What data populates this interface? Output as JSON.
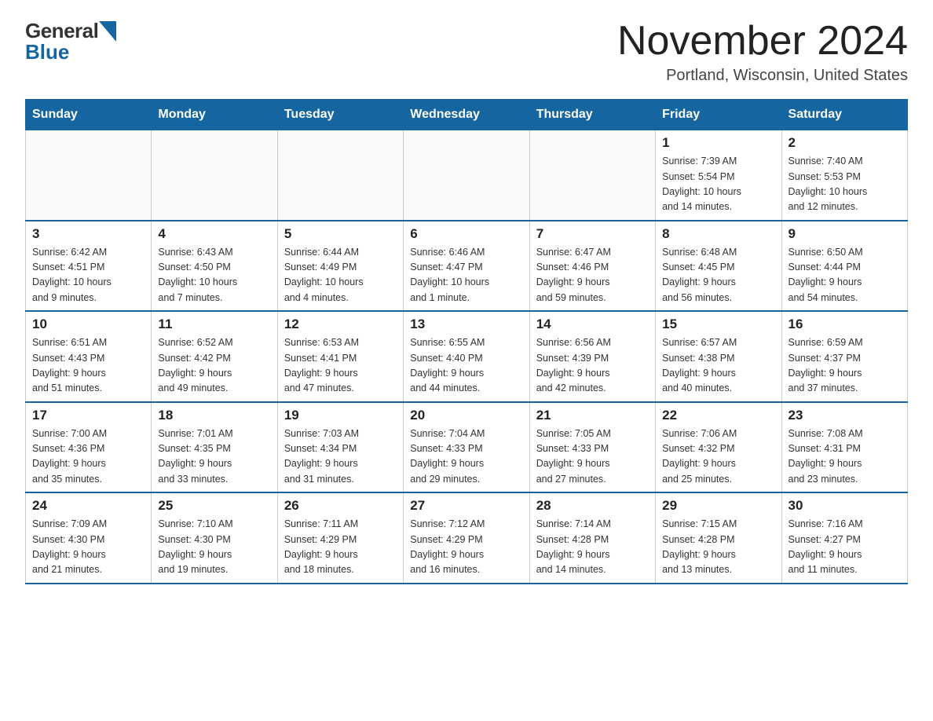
{
  "logo": {
    "general": "General",
    "blue": "Blue"
  },
  "title": "November 2024",
  "location": "Portland, Wisconsin, United States",
  "days_of_week": [
    "Sunday",
    "Monday",
    "Tuesday",
    "Wednesday",
    "Thursday",
    "Friday",
    "Saturday"
  ],
  "weeks": [
    [
      {
        "day": "",
        "info": ""
      },
      {
        "day": "",
        "info": ""
      },
      {
        "day": "",
        "info": ""
      },
      {
        "day": "",
        "info": ""
      },
      {
        "day": "",
        "info": ""
      },
      {
        "day": "1",
        "info": "Sunrise: 7:39 AM\nSunset: 5:54 PM\nDaylight: 10 hours\nand 14 minutes."
      },
      {
        "day": "2",
        "info": "Sunrise: 7:40 AM\nSunset: 5:53 PM\nDaylight: 10 hours\nand 12 minutes."
      }
    ],
    [
      {
        "day": "3",
        "info": "Sunrise: 6:42 AM\nSunset: 4:51 PM\nDaylight: 10 hours\nand 9 minutes."
      },
      {
        "day": "4",
        "info": "Sunrise: 6:43 AM\nSunset: 4:50 PM\nDaylight: 10 hours\nand 7 minutes."
      },
      {
        "day": "5",
        "info": "Sunrise: 6:44 AM\nSunset: 4:49 PM\nDaylight: 10 hours\nand 4 minutes."
      },
      {
        "day": "6",
        "info": "Sunrise: 6:46 AM\nSunset: 4:47 PM\nDaylight: 10 hours\nand 1 minute."
      },
      {
        "day": "7",
        "info": "Sunrise: 6:47 AM\nSunset: 4:46 PM\nDaylight: 9 hours\nand 59 minutes."
      },
      {
        "day": "8",
        "info": "Sunrise: 6:48 AM\nSunset: 4:45 PM\nDaylight: 9 hours\nand 56 minutes."
      },
      {
        "day": "9",
        "info": "Sunrise: 6:50 AM\nSunset: 4:44 PM\nDaylight: 9 hours\nand 54 minutes."
      }
    ],
    [
      {
        "day": "10",
        "info": "Sunrise: 6:51 AM\nSunset: 4:43 PM\nDaylight: 9 hours\nand 51 minutes."
      },
      {
        "day": "11",
        "info": "Sunrise: 6:52 AM\nSunset: 4:42 PM\nDaylight: 9 hours\nand 49 minutes."
      },
      {
        "day": "12",
        "info": "Sunrise: 6:53 AM\nSunset: 4:41 PM\nDaylight: 9 hours\nand 47 minutes."
      },
      {
        "day": "13",
        "info": "Sunrise: 6:55 AM\nSunset: 4:40 PM\nDaylight: 9 hours\nand 44 minutes."
      },
      {
        "day": "14",
        "info": "Sunrise: 6:56 AM\nSunset: 4:39 PM\nDaylight: 9 hours\nand 42 minutes."
      },
      {
        "day": "15",
        "info": "Sunrise: 6:57 AM\nSunset: 4:38 PM\nDaylight: 9 hours\nand 40 minutes."
      },
      {
        "day": "16",
        "info": "Sunrise: 6:59 AM\nSunset: 4:37 PM\nDaylight: 9 hours\nand 37 minutes."
      }
    ],
    [
      {
        "day": "17",
        "info": "Sunrise: 7:00 AM\nSunset: 4:36 PM\nDaylight: 9 hours\nand 35 minutes."
      },
      {
        "day": "18",
        "info": "Sunrise: 7:01 AM\nSunset: 4:35 PM\nDaylight: 9 hours\nand 33 minutes."
      },
      {
        "day": "19",
        "info": "Sunrise: 7:03 AM\nSunset: 4:34 PM\nDaylight: 9 hours\nand 31 minutes."
      },
      {
        "day": "20",
        "info": "Sunrise: 7:04 AM\nSunset: 4:33 PM\nDaylight: 9 hours\nand 29 minutes."
      },
      {
        "day": "21",
        "info": "Sunrise: 7:05 AM\nSunset: 4:33 PM\nDaylight: 9 hours\nand 27 minutes."
      },
      {
        "day": "22",
        "info": "Sunrise: 7:06 AM\nSunset: 4:32 PM\nDaylight: 9 hours\nand 25 minutes."
      },
      {
        "day": "23",
        "info": "Sunrise: 7:08 AM\nSunset: 4:31 PM\nDaylight: 9 hours\nand 23 minutes."
      }
    ],
    [
      {
        "day": "24",
        "info": "Sunrise: 7:09 AM\nSunset: 4:30 PM\nDaylight: 9 hours\nand 21 minutes."
      },
      {
        "day": "25",
        "info": "Sunrise: 7:10 AM\nSunset: 4:30 PM\nDaylight: 9 hours\nand 19 minutes."
      },
      {
        "day": "26",
        "info": "Sunrise: 7:11 AM\nSunset: 4:29 PM\nDaylight: 9 hours\nand 18 minutes."
      },
      {
        "day": "27",
        "info": "Sunrise: 7:12 AM\nSunset: 4:29 PM\nDaylight: 9 hours\nand 16 minutes."
      },
      {
        "day": "28",
        "info": "Sunrise: 7:14 AM\nSunset: 4:28 PM\nDaylight: 9 hours\nand 14 minutes."
      },
      {
        "day": "29",
        "info": "Sunrise: 7:15 AM\nSunset: 4:28 PM\nDaylight: 9 hours\nand 13 minutes."
      },
      {
        "day": "30",
        "info": "Sunrise: 7:16 AM\nSunset: 4:27 PM\nDaylight: 9 hours\nand 11 minutes."
      }
    ]
  ]
}
